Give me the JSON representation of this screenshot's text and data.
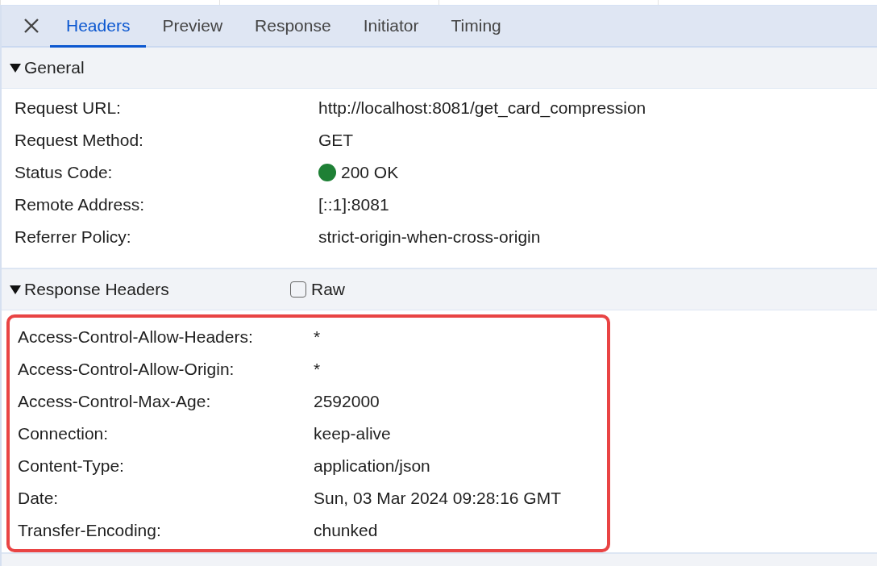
{
  "tabs": [
    {
      "label": "Headers",
      "selected": true
    },
    {
      "label": "Preview",
      "selected": false
    },
    {
      "label": "Response",
      "selected": false
    },
    {
      "label": "Initiator",
      "selected": false
    },
    {
      "label": "Timing",
      "selected": false
    }
  ],
  "sections": [
    {
      "title": "General",
      "expanded": true,
      "highlighted": false,
      "rows": [
        {
          "name": "Request URL:",
          "value": "http://localhost:8081/get_card_compression"
        },
        {
          "name": "Request Method:",
          "value": "GET"
        },
        {
          "name": "Status Code:",
          "value": "200 OK",
          "color": "#1e8035"
        },
        {
          "name": "Remote Address:",
          "value": "[::1]:8081"
        },
        {
          "name": "Referrer Policy:",
          "value": "strict-origin-when-cross-origin"
        }
      ]
    },
    {
      "title": "Response Headers",
      "expanded": true,
      "highlighted": true,
      "raw": {
        "label": "Raw",
        "checked": false
      },
      "rows": [
        {
          "name": "Access-Control-Allow-Headers:",
          "value": "*"
        },
        {
          "name": "Access-Control-Allow-Origin:",
          "value": "*"
        },
        {
          "name": "Access-Control-Max-Age:",
          "value": "2592000"
        },
        {
          "name": "Connection:",
          "value": "keep-alive"
        },
        {
          "name": "Content-Type:",
          "value": "application/json"
        },
        {
          "name": "Date:",
          "value": "Sun, 03 Mar 2024 09:28:16 GMT"
        },
        {
          "name": "Transfer-Encoding:",
          "value": "chunked"
        }
      ]
    }
  ]
}
